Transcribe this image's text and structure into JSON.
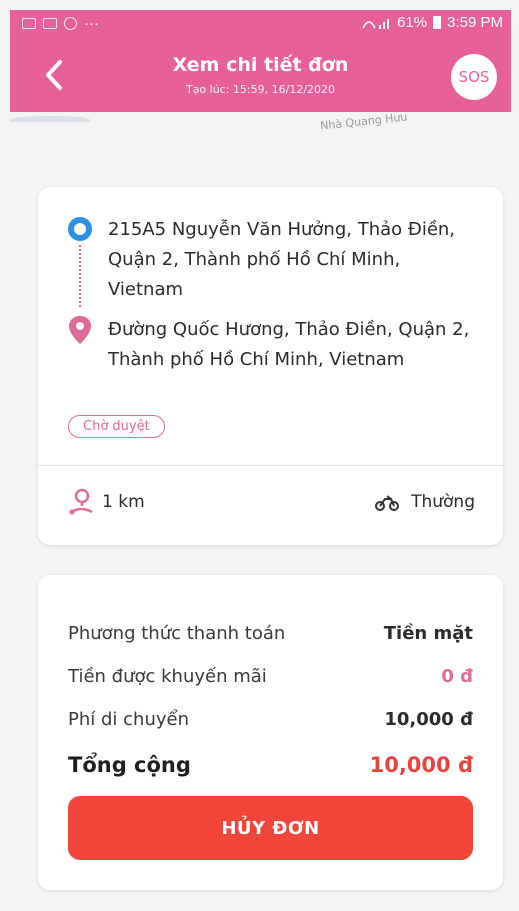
{
  "status_bar": {
    "battery": "61%",
    "time": "3:59 PM"
  },
  "header": {
    "title": "Xem chi tiết đơn",
    "subtitle": "Tạo lúc: 15:59, 16/12/2020",
    "sos_label": "SOS",
    "back_icon": "chevron-left-icon"
  },
  "map": {
    "street_label": "Nhà Quang Hưu"
  },
  "route": {
    "pickup_address": "215A5 Nguyễn Văn Hưởng, Thảo Điền, Quận 2, Thành phố Hồ Chí Minh, Vietnam",
    "dropoff_address": "Đường Quốc Hương, Thảo Điền, Quận 2, Thành phố Hồ Chí Minh, Vietnam",
    "status": "Chờ duyệt",
    "distance": "1 km",
    "vehicle": "Thường"
  },
  "payment": {
    "method_label": "Phương thức thanh toán",
    "method_value": "Tiền mặt",
    "promo_label": "Tiền được khuyến mãi",
    "promo_value": "0 đ",
    "fee_label": "Phí di chuyển",
    "fee_value": "10,000 đ",
    "total_label": "Tổng cộng",
    "total_value": "10,000 đ",
    "cancel_label": "HỦY ĐƠN"
  },
  "colors": {
    "brand": "#e8609a",
    "pickup": "#2c8ee6",
    "cancel": "#f2453a",
    "total": "#e8443e"
  }
}
